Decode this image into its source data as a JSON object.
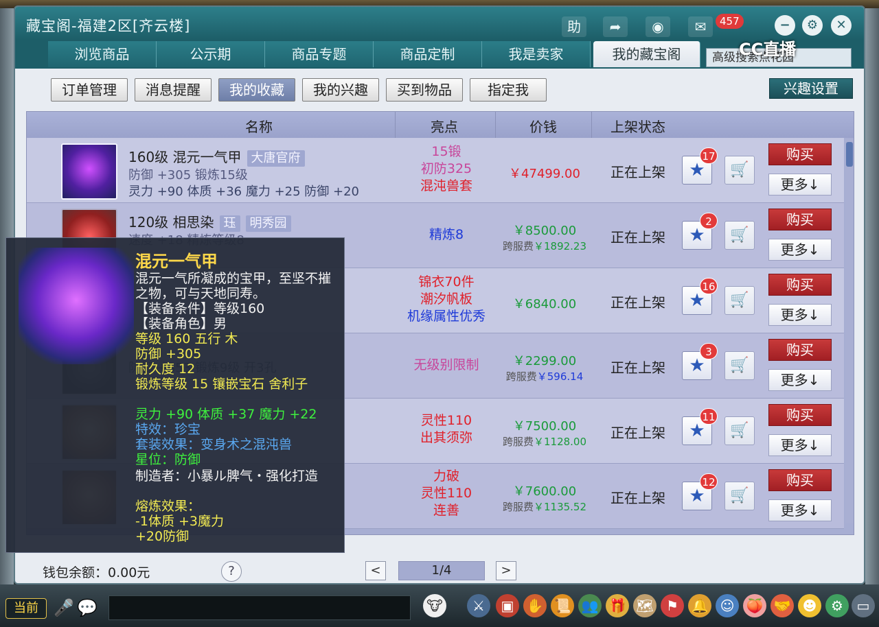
{
  "window": {
    "title": "藏宝阁-福建2区[齐云楼]",
    "help_label": "助",
    "notify_count": "457",
    "watermark": "CC直播"
  },
  "main_tabs": [
    {
      "label": "浏览商品"
    },
    {
      "label": "公示期"
    },
    {
      "label": "商品专题"
    },
    {
      "label": "商品定制"
    },
    {
      "label": "我是卖家"
    },
    {
      "label": "我的藏宝阁"
    }
  ],
  "search_text": "高级搜索点花园",
  "sub_tabs": [
    {
      "label": "订单管理"
    },
    {
      "label": "消息提醒"
    },
    {
      "label": "我的收藏"
    },
    {
      "label": "我的兴趣"
    },
    {
      "label": "买到物品"
    },
    {
      "label": "指定我"
    }
  ],
  "interest_settings_label": "兴趣设置",
  "columns": {
    "name": "名称",
    "highlight": "亮点",
    "price": "价钱",
    "status": "上架状态"
  },
  "rows": [
    {
      "name": "160级 混元一气甲",
      "tag": "大唐官府",
      "attr1": "防御 +305 锻炼15级",
      "attr2": "灵力 +90 体质 +36 魔力 +25 防御 +20",
      "hl": [
        {
          "t": "15锻",
          "c": "p"
        },
        {
          "t": "初防325",
          "c": "p"
        },
        {
          "t": "混沌兽套",
          "c": "r"
        }
      ],
      "price": "￥47499.00",
      "price_color": "red",
      "cross_label": "",
      "cross_value": "",
      "status": "正在上架",
      "fav": "17",
      "buy": "购买",
      "more": "更多↓"
    },
    {
      "name": "120级 相思染",
      "tag": "珏",
      "tag2": "明秀园",
      "attr1": "速度 +18 精炼等级8",
      "attr2": "",
      "hl": [
        {
          "t": "精炼8",
          "c": "b"
        }
      ],
      "price": "￥8500.00",
      "price_color": "green",
      "cross_label": "跨服费",
      "cross_value": "￥1892.23",
      "status": "正在上架",
      "fav": "2",
      "buy": "购买",
      "more": "更多↓"
    },
    {
      "name": "",
      "tag": "",
      "attr1": "",
      "attr2": "",
      "hl": [
        {
          "t": "锦衣70件",
          "c": "r"
        },
        {
          "t": "潮汐帆板",
          "c": "r"
        },
        {
          "t": "机缘属性优秀",
          "c": "b"
        }
      ],
      "price": "￥6840.00",
      "price_color": "green",
      "cross_label": "",
      "cross_value": "",
      "status": "正在上架",
      "fav": "16",
      "buy": "购买",
      "more": "更多↓"
    },
    {
      "name": "",
      "tag": "",
      "attr1": "",
      "attr2": "防御 +353 锻炼9级 开3孔",
      "hl": [
        {
          "t": "无级别限制",
          "c": "p"
        }
      ],
      "price": "￥2299.00",
      "price_color": "green",
      "cross_label": "跨服费",
      "cross_value": "￥596.14",
      "status": "正在上架",
      "fav": "3",
      "buy": "购买",
      "more": "更多↓"
    },
    {
      "name": "",
      "tag": "",
      "attr1": "",
      "attr2": "",
      "hl": [
        {
          "t": "灵性110",
          "c": "r"
        },
        {
          "t": "出其须弥",
          "c": "r"
        }
      ],
      "price": "￥7500.00",
      "price_color": "green",
      "cross_label": "跨服费",
      "cross_value": "￥1128.00",
      "status": "正在上架",
      "fav": "11",
      "buy": "购买",
      "more": "更多↓"
    },
    {
      "name": "",
      "tag": "",
      "attr1": "",
      "attr2": "",
      "hl": [
        {
          "t": "力破",
          "c": "r"
        },
        {
          "t": "灵性110",
          "c": "r"
        },
        {
          "t": "连善",
          "c": "r"
        }
      ],
      "price": "￥7600.00",
      "price_color": "green",
      "cross_label": "跨服费",
      "cross_value": "￥1135.52",
      "status": "正在上架",
      "fav": "12",
      "buy": "购买",
      "more": "更多↓"
    }
  ],
  "footer": {
    "wallet": "钱包余额：0.00元",
    "help": "?",
    "page": "1/4",
    "prev": "<",
    "next": ">"
  },
  "tooltip": {
    "title": "混元一气甲",
    "lines": [
      {
        "t": "混元一气所凝成的宝甲，至坚不摧之物，可与天地同寿。",
        "c": "white",
        "wrap": true
      },
      {
        "t": "【装备条件】等级160",
        "c": "white"
      },
      {
        "t": "【装备角色】男",
        "c": "white"
      },
      {
        "t": "等级 160  五行 木",
        "c": "yellow"
      },
      {
        "t": "防御 +305",
        "c": "yellow"
      },
      {
        "t": "耐久度 12",
        "c": "yellow"
      },
      {
        "t": "锻炼等级 15  镶嵌宝石 舍利子",
        "c": "yellow",
        "wrap": true
      },
      {
        "t": "灵力 +90 体质 +37 魔力 +22",
        "c": "green"
      },
      {
        "t": "特效：珍宝",
        "c": "blue"
      },
      {
        "t": "套装效果：变身术之混沌兽",
        "c": "blue"
      },
      {
        "t": "星位：防御",
        "c": "green"
      },
      {
        "t": "制造者：小暴ル脾气・强化打造",
        "c": "white",
        "wrap": true
      },
      {
        "t": "熔炼效果：",
        "c": "yellow"
      },
      {
        "t": "-1体质 +3魔力",
        "c": "yellow"
      },
      {
        "t": "+20防御",
        "c": "yellow"
      }
    ]
  },
  "game_bar": {
    "current_label": "当前"
  }
}
